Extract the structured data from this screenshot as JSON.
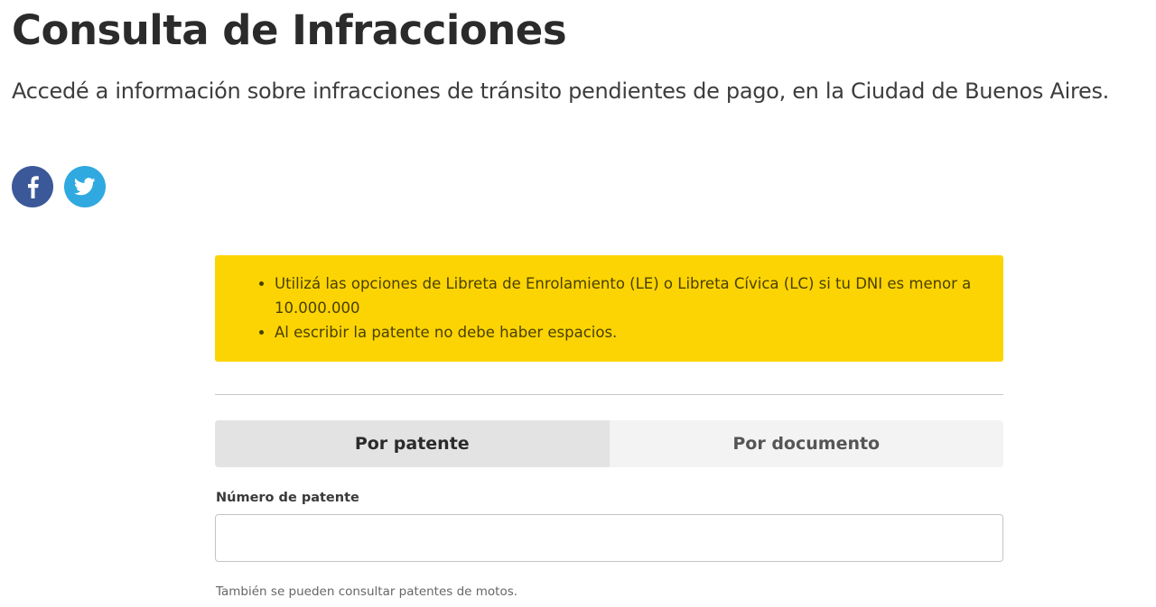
{
  "header": {
    "title": "Consulta de Infracciones",
    "subtitle": "Accedé a información sobre infracciones de tránsito pendientes de pago, en la Ciudad de Buenos Aires."
  },
  "social": {
    "facebook_icon": "facebook-icon",
    "twitter_icon": "twitter-icon",
    "facebook_color": "#3b5998",
    "twitter_color": "#2fa9e0"
  },
  "notice": {
    "background": "#fcd403",
    "items": [
      "Utilizá las opciones de Libreta de Enrolamiento (LE) o Libreta Cívica (LC) si tu DNI es menor a 10.000.000",
      "Al escribir la patente no debe haber espacios."
    ]
  },
  "tabs": [
    {
      "label": "Por patente",
      "active": true
    },
    {
      "label": "Por documento",
      "active": false
    }
  ],
  "form": {
    "label": "Número de patente",
    "value": "",
    "placeholder": "",
    "helper": "También se pueden consultar patentes de motos."
  }
}
